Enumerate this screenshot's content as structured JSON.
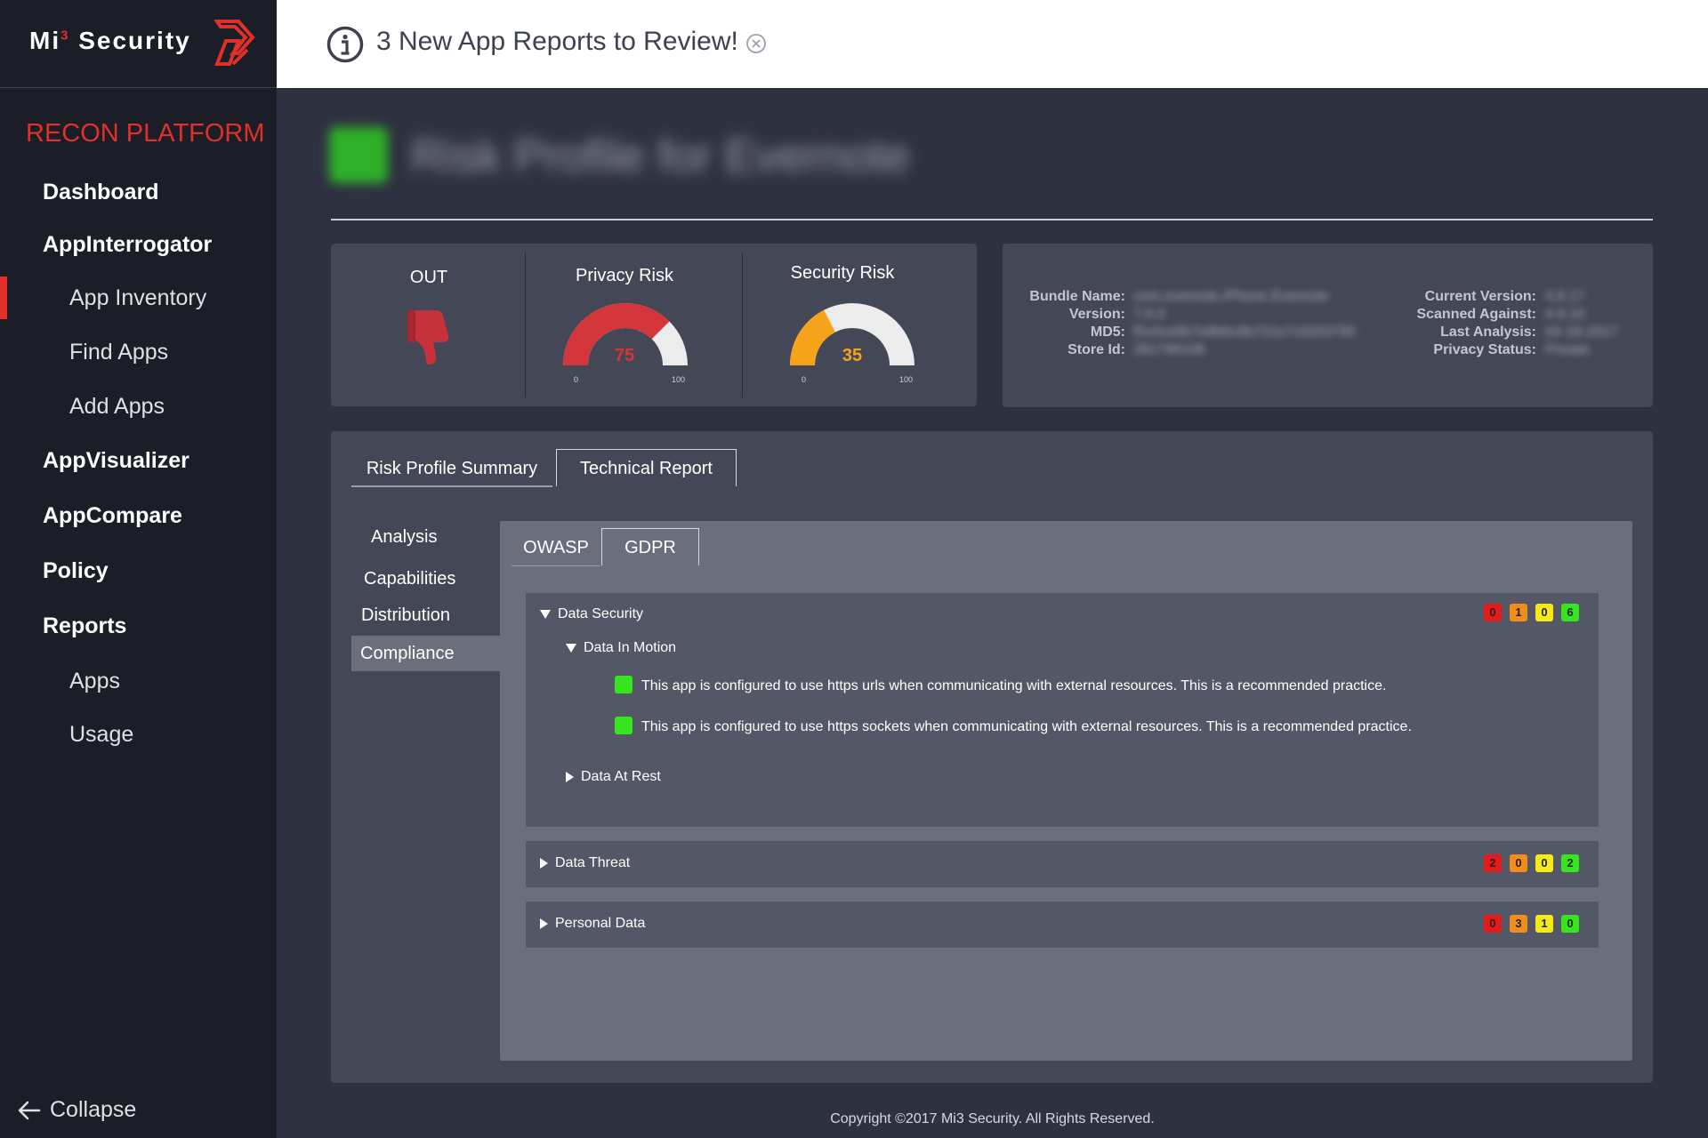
{
  "brand": {
    "name": "Mi",
    "superscript": "3",
    "suffix": "Security",
    "accent": "#e1302a"
  },
  "sidebar": {
    "platform_title": "RECON PLATFORM",
    "items": [
      {
        "label": "Dashboard",
        "level": "top"
      },
      {
        "label": "AppInterrogator",
        "level": "top"
      },
      {
        "label": "App Inventory",
        "level": "sub",
        "active": true
      },
      {
        "label": "Find Apps",
        "level": "sub"
      },
      {
        "label": "Add Apps",
        "level": "sub"
      },
      {
        "label": "AppVisualizer",
        "level": "top"
      },
      {
        "label": "AppCompare",
        "level": "top"
      },
      {
        "label": "Policy",
        "level": "top"
      },
      {
        "label": "Reports",
        "level": "top"
      },
      {
        "label": "Apps",
        "level": "sub"
      },
      {
        "label": "Usage",
        "level": "sub"
      }
    ],
    "collapse_label": "Collapse"
  },
  "header": {
    "message": "3 New App Reports to Review!",
    "icon": "info-icon"
  },
  "app": {
    "title": "Risk Profile for Evernote"
  },
  "risk": {
    "status_label": "OUT",
    "status_icon": "thumbs-down-icon",
    "privacy": {
      "label": "Privacy Risk",
      "value": 75,
      "min": "0",
      "max": "100",
      "color": "#d2363a"
    },
    "security": {
      "label": "Security Risk",
      "value": 35,
      "min": "0",
      "max": "100",
      "color": "#f7a21b"
    }
  },
  "meta": {
    "left": [
      {
        "label": "Bundle Name:",
        "value": "com.evernote.iPhone.Evernote"
      },
      {
        "label": "Version:",
        "value": "7.6.0"
      },
      {
        "label": "MD5:",
        "value": "f5c0ce8b7e8b6c8b721e7c0203795"
      },
      {
        "label": "Store Id:",
        "value": "281796108"
      }
    ],
    "right": [
      {
        "label": "Current Version:",
        "value": "4.8.17"
      },
      {
        "label": "Scanned Against:",
        "value": "4.8.10"
      },
      {
        "label": "Last Analysis:",
        "value": "04-18-2017"
      },
      {
        "label": "Privacy Status:",
        "value": "Private"
      }
    ]
  },
  "tabs": {
    "summary": "Risk Profile Summary",
    "technical": "Technical Report"
  },
  "side_nav": [
    "Analysis",
    "Capabilities",
    "Distribution",
    "Compliance"
  ],
  "inner_tabs": {
    "owasp": "OWASP",
    "gdpr": "GDPR"
  },
  "sections": {
    "security": {
      "title": "Data Security",
      "badges": [
        "0",
        "1",
        "0",
        "6"
      ],
      "sub_motion": "Data In Motion",
      "findings": [
        "This app is configured to use https urls when communicating with external resources. This is a recommended practice.",
        "This app is configured to use https sockets when communicating with external resources. This is a recommended practice."
      ],
      "sub_rest": "Data At Rest"
    },
    "threat": {
      "title": "Data Threat",
      "badges": [
        "2",
        "0",
        "0",
        "2"
      ]
    },
    "personal": {
      "title": "Personal Data",
      "badges": [
        "0",
        "3",
        "1",
        "0"
      ]
    }
  },
  "badge_colors": [
    "#e41b1b",
    "#f28c1c",
    "#f3ea17",
    "#37e51e"
  ],
  "footer": "Copyright ©2017 Mi3 Security. All Rights Reserved."
}
